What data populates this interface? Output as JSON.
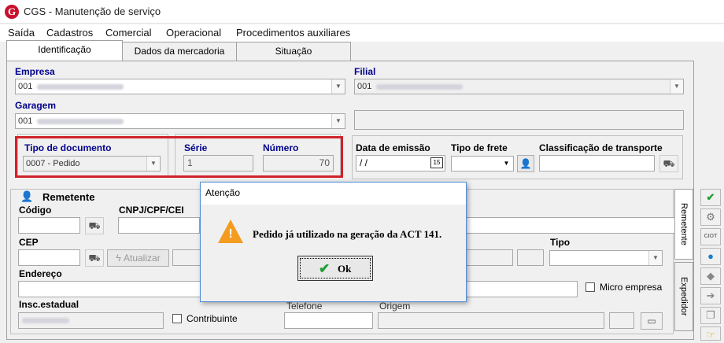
{
  "window": {
    "title": "CGS - Manutenção de serviço",
    "logo": "G"
  },
  "menu": [
    "Saída",
    "Cadastros",
    "Comercial",
    "Operacional",
    "Procedimentos auxiliares"
  ],
  "tabs": [
    "Identificação",
    "Dados da mercadoria",
    "Situação"
  ],
  "identificacao": {
    "empresa_label": "Empresa",
    "empresa_value": "001",
    "filial_label": "Filial",
    "filial_value": "001",
    "garagem_label": "Garagem",
    "garagem_value": "001",
    "tipo_doc_label": "Tipo de documento",
    "tipo_doc_value": "0007 - Pedido",
    "serie_label": "Série",
    "serie_value": "1",
    "numero_label": "Número",
    "numero_value": "70",
    "data_emissao_label": "Data de emissão",
    "data_emissao_value": "/ /",
    "tipo_frete_label": "Tipo de frete",
    "classificacao_label": "Classificação de transporte"
  },
  "remetente": {
    "title": "Remetente",
    "codigo_label": "Código",
    "cnpj_label": "CNPJ/CPF/CEI",
    "cep_label": "CEP",
    "atualizar_label": "Atualizar",
    "tipo_label": "Tipo",
    "endereco_label": "Endereço",
    "micro_empresa_label": "Micro empresa",
    "insc_estadual_label": "Insc.estadual",
    "contribuinte_label": "Contribuinte",
    "telefone_label": "Telefone",
    "origem_label": "Origem"
  },
  "side_tabs": [
    "Remetente",
    "Expedidor"
  ],
  "toolbar_icons": [
    "confirm-check-icon",
    "settings-gears-icon",
    "ciot-icon",
    "globe-icon",
    "eraser-icon",
    "export-arrow-icon",
    "copy-pages-icon",
    "hand-pointer-icon"
  ],
  "dialog": {
    "title": "Atenção",
    "message": "Pedido já utilizado na geração da ACT 141.",
    "ok_label": "Ok"
  },
  "colors": {
    "label_blue": "#00008b",
    "highlight_red": "#d0222a",
    "warning_orange": "#f39c1f",
    "ok_green": "#1e9e32"
  }
}
